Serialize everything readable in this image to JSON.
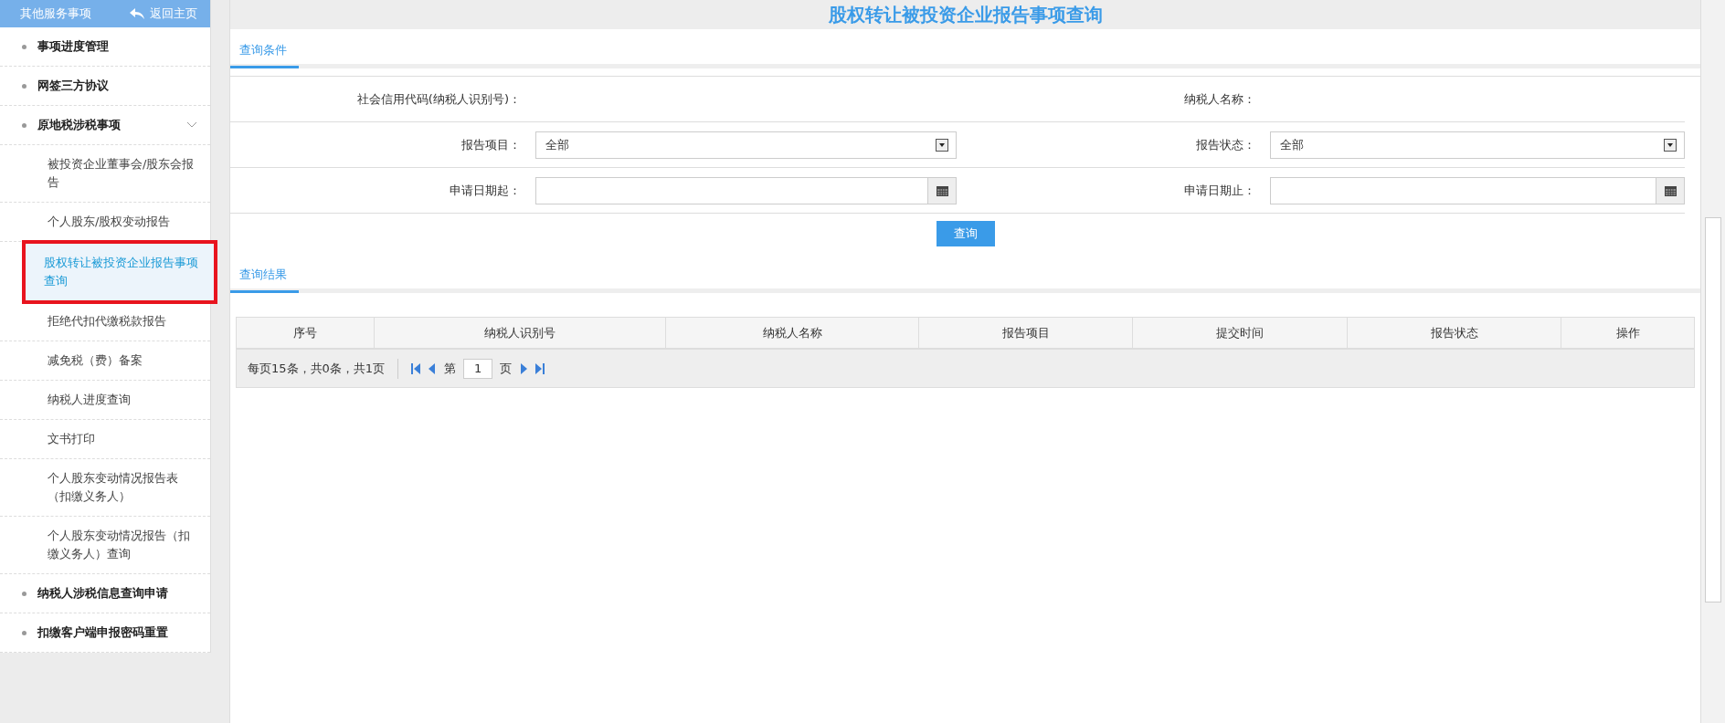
{
  "sidebar": {
    "title": "其他服务事项",
    "back_link": "返回主页",
    "items": [
      {
        "label": "事项进度管理",
        "selected": false
      },
      {
        "label": "网签三方协议",
        "selected": false
      },
      {
        "label": "原地税涉税事项",
        "selected": false,
        "expanded": true,
        "children": [
          {
            "label": "被投资企业董事会/股东会报告",
            "selected": false
          },
          {
            "label": "个人股东/股权变动报告",
            "selected": false
          },
          {
            "label": "股权转让被投资企业报告事项查询",
            "selected": true
          },
          {
            "label": "拒绝代扣代缴税款报告",
            "selected": false
          },
          {
            "label": "减免税（费）备案",
            "selected": false
          },
          {
            "label": "纳税人进度查询",
            "selected": false
          },
          {
            "label": "文书打印",
            "selected": false
          },
          {
            "label": "个人股东变动情况报告表（扣缴义务人）",
            "selected": false
          },
          {
            "label": "个人股东变动情况报告（扣缴义务人）查询",
            "selected": false
          }
        ]
      },
      {
        "label": "纳税人涉税信息查询申请",
        "selected": false
      },
      {
        "label": "扣缴客户端申报密码重置",
        "selected": false
      }
    ]
  },
  "page_title": "股权转让被投资企业报告事项查询",
  "query_section": {
    "tab": "查询条件",
    "selected": true,
    "fields": [
      {
        "label": "社会信用代码(纳税人识别号)：",
        "kind": "static"
      },
      {
        "label": "纳税人名称：",
        "kind": "static"
      },
      {
        "label": "报告项目：",
        "kind": "select",
        "value": "全部"
      },
      {
        "label": "报告状态：",
        "kind": "select",
        "value": "全部"
      },
      {
        "label": "申请日期起：",
        "kind": "date"
      },
      {
        "label": "申请日期止：",
        "kind": "date"
      }
    ],
    "button": "查询"
  },
  "result_section": {
    "tab": "查询结果",
    "selected": true,
    "columns": [
      "序号",
      "纳税人识别号",
      "纳税人名称",
      "报告项目",
      "提交时间",
      "报告状态",
      "操作"
    ],
    "pager": {
      "summary": "每页15条，共0条，共1页",
      "page_prefix": "第",
      "page": "1",
      "page_suffix": "页"
    }
  }
}
